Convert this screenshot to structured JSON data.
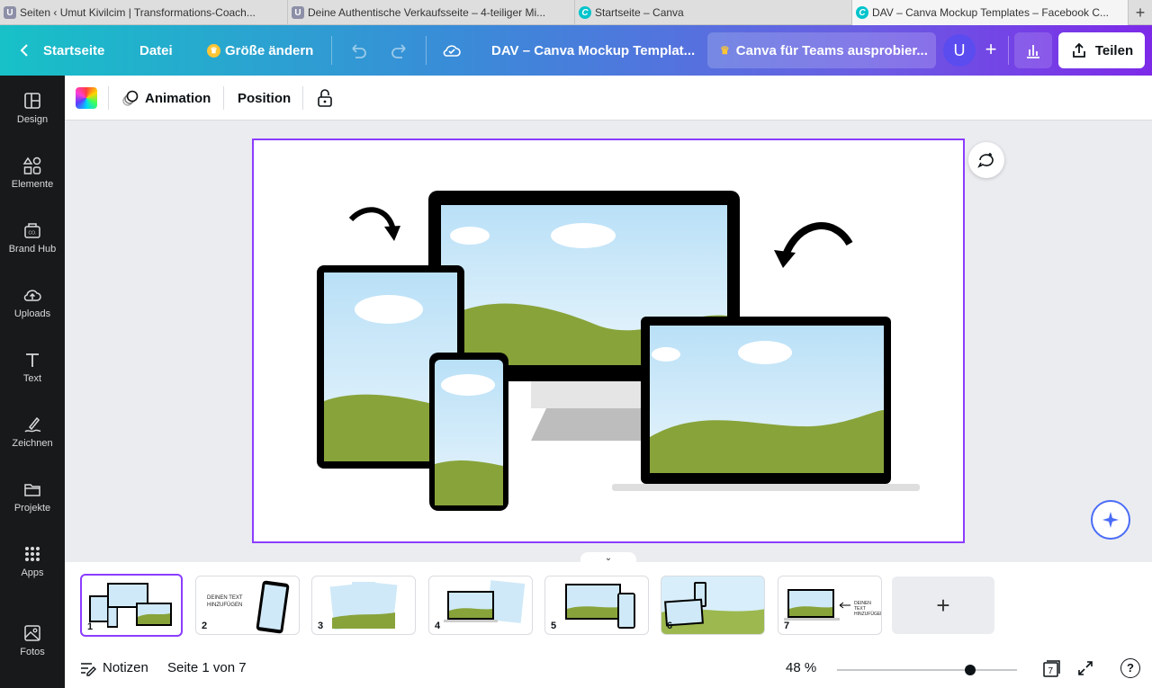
{
  "browser": {
    "tabs": [
      {
        "label": "Seiten ‹ Umut Kivilcim | Transformations-Coach...",
        "favicon": "U"
      },
      {
        "label": "Deine Authentische Verkaufsseite – 4-teiliger Mi...",
        "favicon": "U"
      },
      {
        "label": "Startseite – Canva",
        "favicon": "C"
      },
      {
        "label": "DAV – Canva Mockup Templates – Facebook C...",
        "favicon": "C"
      }
    ],
    "new_tab": "+"
  },
  "topbar": {
    "home": "Startseite",
    "file": "Datei",
    "resize": "Größe ändern",
    "title": "DAV – Canva Mockup Templat...",
    "teams": "Canva für Teams ausprobier...",
    "avatar": "U",
    "share": "Teilen"
  },
  "sidebar": [
    {
      "label": "Design",
      "icon": "layout-icon"
    },
    {
      "label": "Elemente",
      "icon": "shapes-icon"
    },
    {
      "label": "Brand Hub",
      "icon": "brand-hub-icon"
    },
    {
      "label": "Uploads",
      "icon": "cloud-upload-icon"
    },
    {
      "label": "Text",
      "icon": "text-icon"
    },
    {
      "label": "Zeichnen",
      "icon": "draw-icon"
    },
    {
      "label": "Projekte",
      "icon": "folder-icon"
    },
    {
      "label": "Apps",
      "icon": "apps-grid-icon"
    },
    {
      "label": "Fotos",
      "icon": "image-icon"
    }
  ],
  "context_toolbar": {
    "animation": "Animation",
    "position": "Position"
  },
  "thumbnails": [
    {
      "num": "1",
      "text": ""
    },
    {
      "num": "2",
      "text": "DEINEN TEXT HINZUFÜGEN"
    },
    {
      "num": "3",
      "text": ""
    },
    {
      "num": "4",
      "text": ""
    },
    {
      "num": "5",
      "text": ""
    },
    {
      "num": "6",
      "text": ""
    },
    {
      "num": "7",
      "text": "DEINEN TEXT HINZUFÜGEN"
    }
  ],
  "add_page": "+",
  "footer": {
    "notes": "Notizen",
    "page_info": "Seite 1 von 7",
    "zoom": "48 %",
    "zoom_value": 0.48,
    "page_count_badge": "7",
    "help": "?"
  },
  "colors": {
    "accent": "#8b3dff",
    "sidebar_bg": "#18191b",
    "sky": "#cfe9f8",
    "grass": "#88a33a"
  }
}
